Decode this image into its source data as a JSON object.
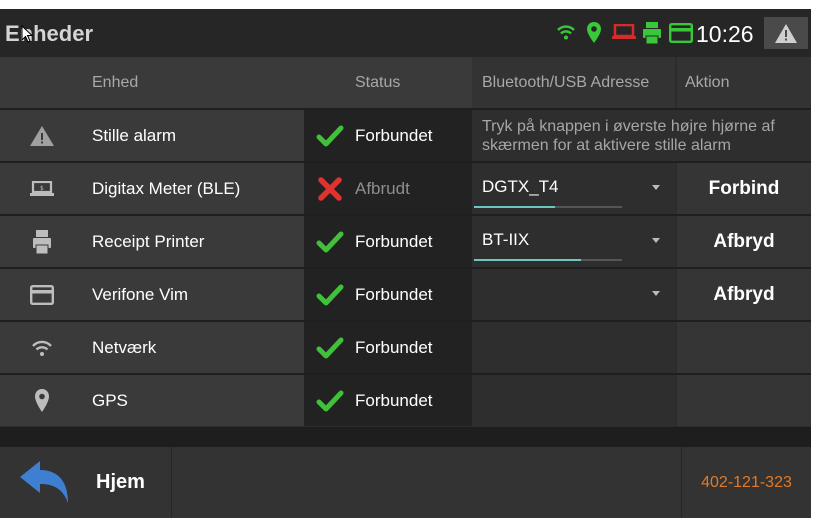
{
  "topbar": {
    "title": "Enheder",
    "time": "10:26",
    "status_colors": {
      "wifi": "#39c83a",
      "gps": "#39c83a",
      "meter": "#d62b2b",
      "printer": "#39c83a",
      "card": "#39c83a"
    }
  },
  "table": {
    "headers": {
      "device": "Enhed",
      "status": "Status",
      "address": "Bluetooth/USB Adresse",
      "action": "Aktion"
    },
    "rows": [
      {
        "icon": "warning-icon",
        "name": "Stille alarm",
        "status": "Forbundet",
        "connected": true,
        "hint": "Tryk på knappen i øverste højre hjørne af skærmen for at aktivere stille alarm"
      },
      {
        "icon": "meter-icon",
        "name": "Digitax Meter (BLE)",
        "status": "Afbrudt",
        "connected": false,
        "address": "DGTX_T4",
        "signal": 0.55,
        "action": "Forbind"
      },
      {
        "icon": "printer-icon",
        "name": "Receipt Printer",
        "status": "Forbundet",
        "connected": true,
        "address": "BT-IIX",
        "signal": 0.72,
        "action": "Afbryd"
      },
      {
        "icon": "card-icon",
        "name": "Verifone Vim",
        "status": "Forbundet",
        "connected": true,
        "address": "",
        "action": "Afbryd"
      },
      {
        "icon": "wifi-icon",
        "name": "Netværk",
        "status": "Forbundet",
        "connected": true
      },
      {
        "icon": "location-pin-icon",
        "name": "GPS",
        "status": "Forbundet",
        "connected": true
      }
    ]
  },
  "footer": {
    "home_label": "Hjem",
    "id_number": "402-121-323"
  },
  "colors": {
    "connected": "#3fc23a",
    "disconnected": "#e0322f",
    "accent": "#6fc5c0",
    "id_text": "#e07a2a"
  }
}
